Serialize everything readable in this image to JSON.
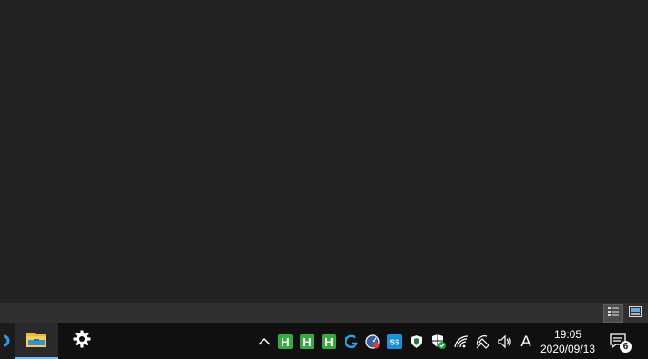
{
  "statusbar": {
    "view_details_icon": "details-view-icon",
    "view_preview_icon": "large-icons-view-icon"
  },
  "taskbar": {
    "items": [
      {
        "name": "edge-app-partial",
        "icon": "app-icon"
      },
      {
        "name": "file-explorer",
        "icon": "folder-icon",
        "active": true
      },
      {
        "name": "settings",
        "icon": "gear-icon"
      }
    ],
    "tray": {
      "icons": [
        "chevron-up-icon",
        "h-app-icon",
        "h-app-icon",
        "h-app-icon",
        "logitech-g-icon",
        "speedometer-icon",
        "ss-app-icon",
        "defender-shield-icon",
        "security-shield-check-icon",
        "wifi-icon",
        "satellite-icon",
        "volume-icon"
      ],
      "ime_label": "A",
      "time": "19:05",
      "date": "2020/09/13",
      "notification_count": "6"
    },
    "colors": {
      "accent": "#76b9ed",
      "h_green": "#3aa845",
      "ss_blue": "#1e90d6"
    }
  }
}
